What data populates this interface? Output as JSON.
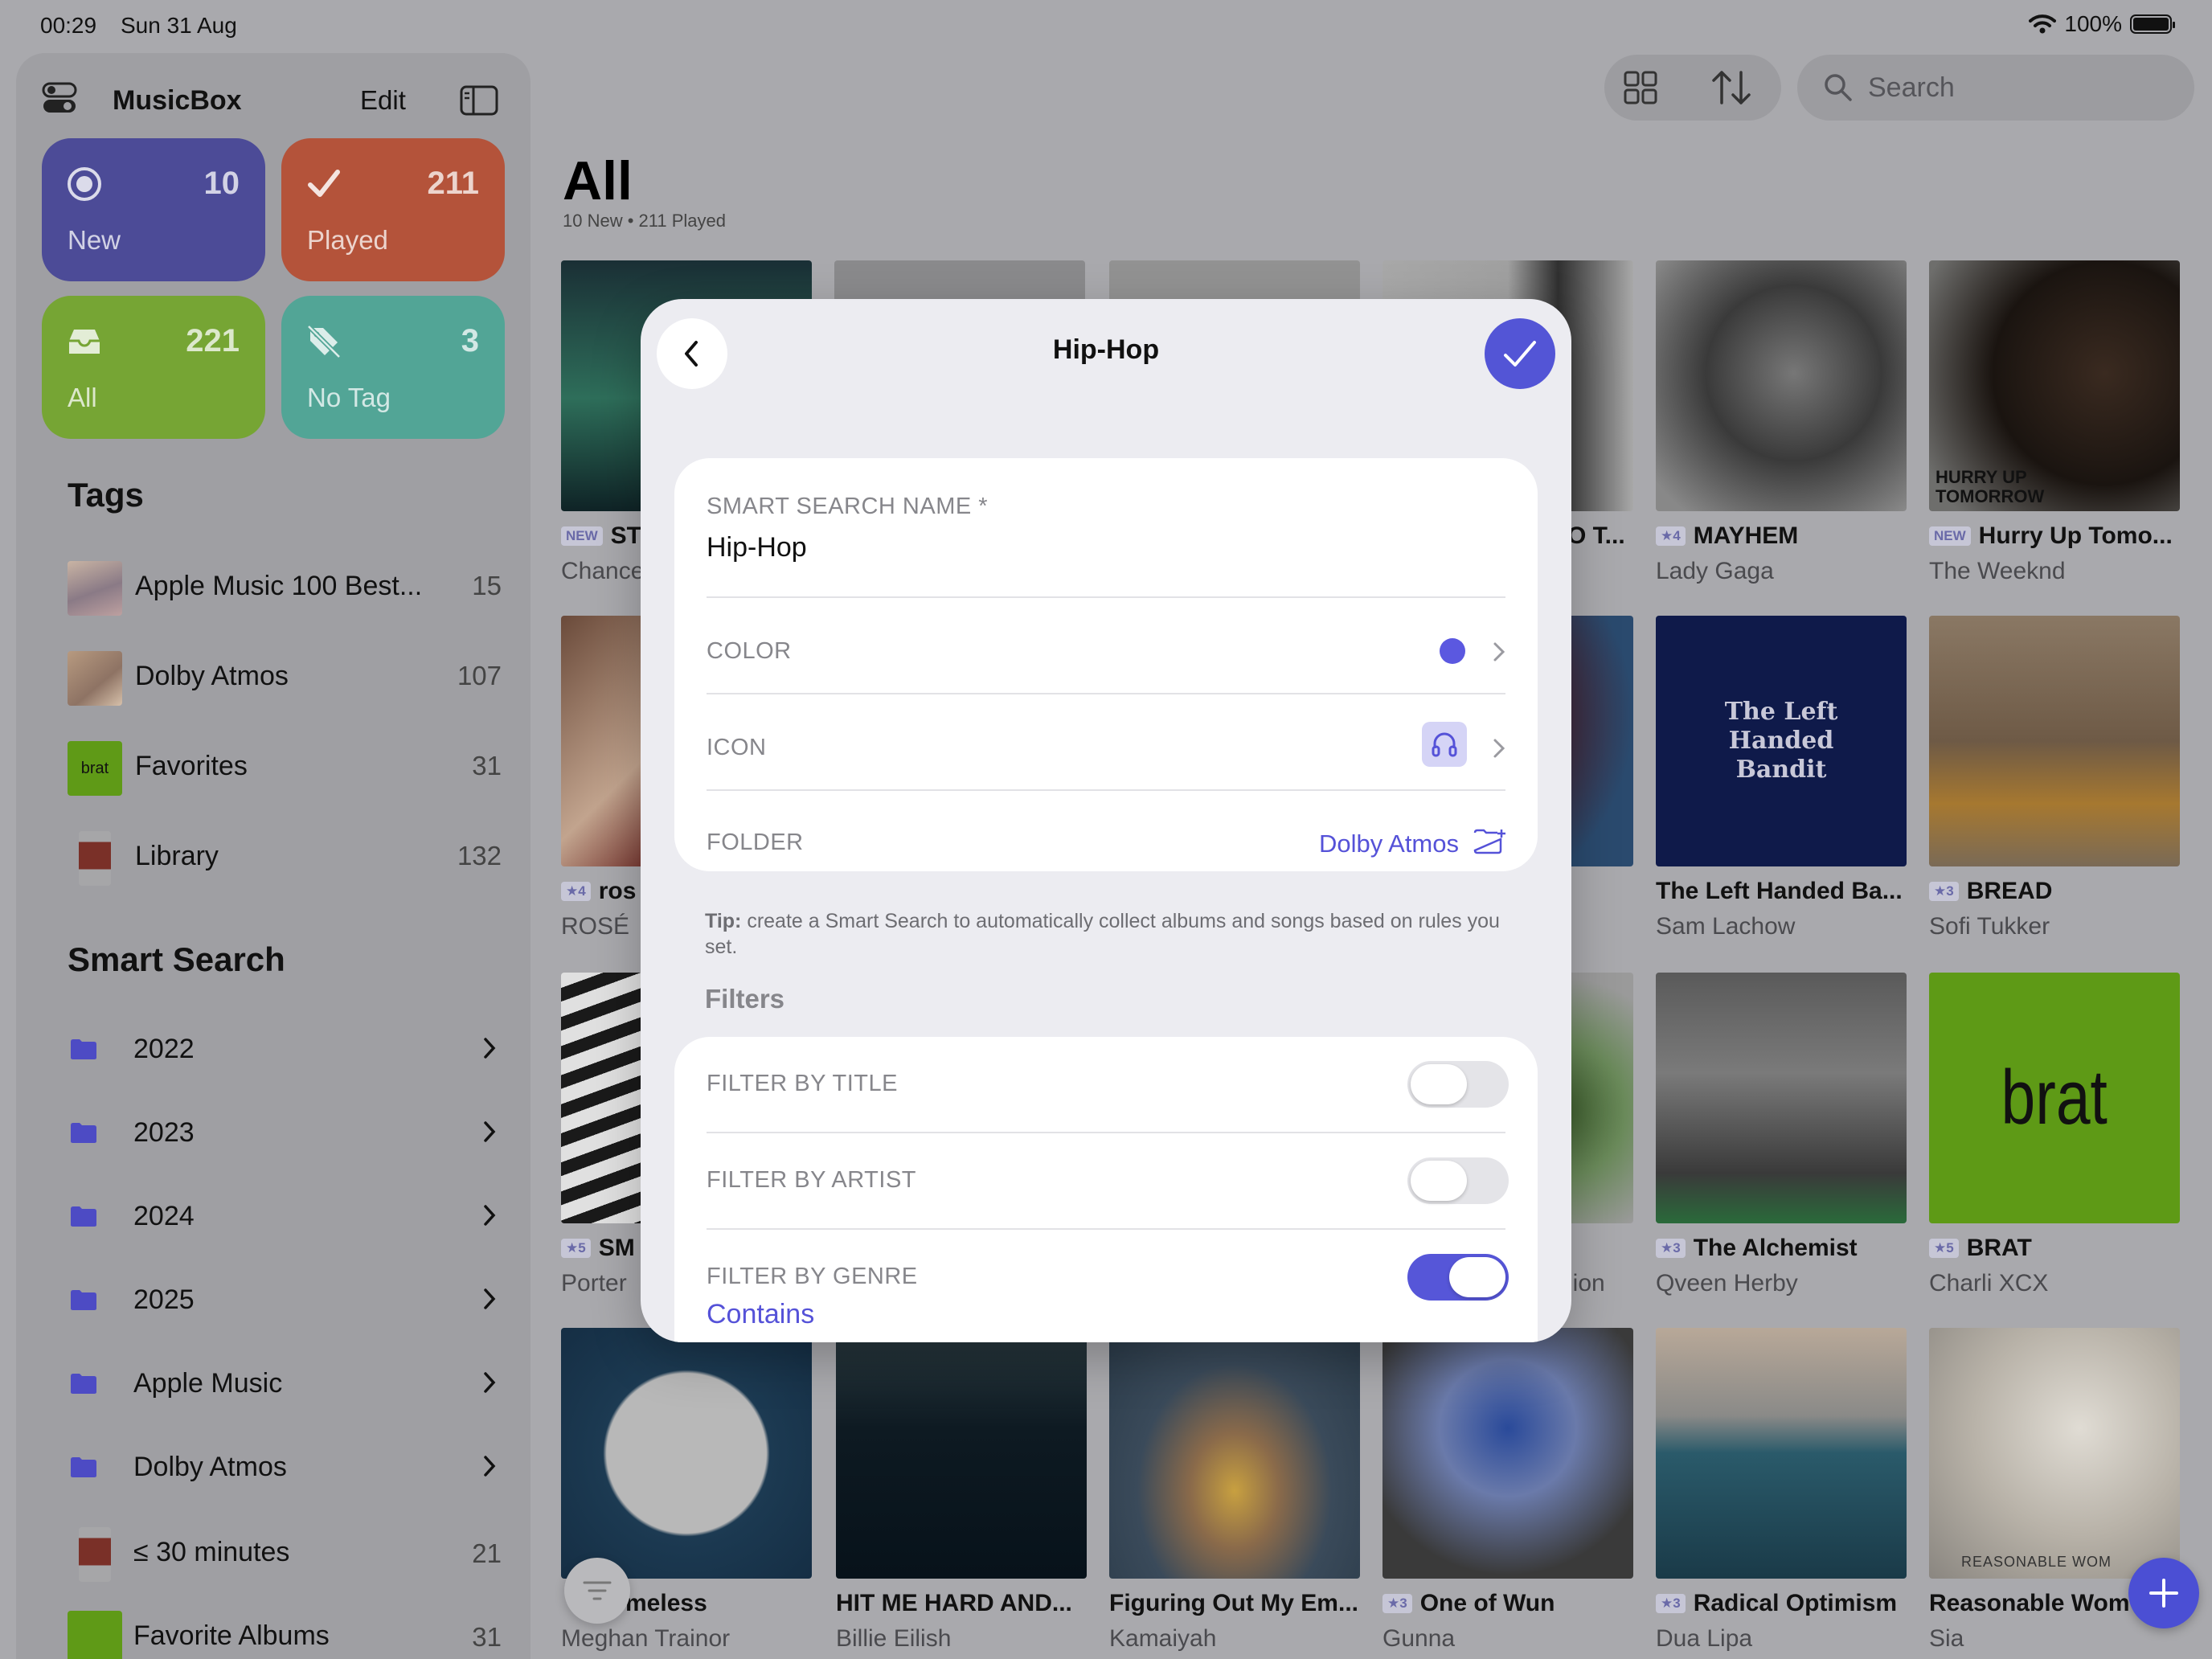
{
  "status_bar": {
    "time": "00:29",
    "date": "Sun 31 Aug",
    "battery": "100%"
  },
  "sidebar": {
    "app_title": "MusicBox",
    "edit_label": "Edit",
    "tiles": [
      {
        "label": "New",
        "count": "10",
        "icon": "circle-dot-icon",
        "color": "#4c4b97"
      },
      {
        "label": "Played",
        "count": "211",
        "icon": "checkmark-icon",
        "color": "#b4533a"
      },
      {
        "label": "All",
        "count": "221",
        "icon": "tray-icon",
        "color": "#76a534"
      },
      {
        "label": "No Tag",
        "count": "3",
        "icon": "tag-slash-icon",
        "color": "#52a596"
      }
    ],
    "tags_title": "Tags",
    "tags": [
      {
        "name": "Apple Music 100 Best...",
        "count": "15"
      },
      {
        "name": "Dolby Atmos",
        "count": "107"
      },
      {
        "name": "Favorites",
        "count": "31",
        "thumb_text": "brat"
      },
      {
        "name": "Library",
        "count": "132"
      }
    ],
    "smart_title": "Smart Search",
    "smart_folders": [
      {
        "name": "2022"
      },
      {
        "name": "2023"
      },
      {
        "name": "2024"
      },
      {
        "name": "2025"
      },
      {
        "name": "Apple Music"
      },
      {
        "name": "Dolby Atmos"
      }
    ],
    "smart_items": [
      {
        "name": "≤ 30 minutes",
        "count": "21"
      },
      {
        "name": "Favorite Albums",
        "count": "31"
      }
    ]
  },
  "toolbar": {
    "search_placeholder": "Search"
  },
  "main": {
    "title": "All",
    "subtitle": "10 New • 211 Played",
    "albums": [
      {
        "title": "ST",
        "artist": "Chance",
        "badge": "NEW"
      },
      {
        "title": "",
        "artist": ""
      },
      {
        "title": "",
        "artist": ""
      },
      {
        "title": "O T...",
        "artist": ""
      },
      {
        "title": "MAYHEM",
        "artist": "Lady Gaga",
        "badge": "★4"
      },
      {
        "title": "Hurry Up Tomo...",
        "artist": "The Weeknd",
        "badge": "NEW",
        "art_text": "HURRY UP TOMORROW"
      },
      {
        "title": "ros",
        "artist": "ROSÉ",
        "badge": "★4"
      },
      {
        "title": "The Left Handed Ba...",
        "artist": "Sam Lachow",
        "art_text": "The Left Handed Bandit"
      },
      {
        "title": "BREAD",
        "artist": "Sofi Tukker",
        "badge": "★3"
      },
      {
        "title": "SM",
        "artist": "Porter",
        "badge": "★5"
      },
      {
        "title": "",
        "artist": "lion"
      },
      {
        "title": "The Alchemist",
        "artist": "Qveen Herby",
        "badge": "★3"
      },
      {
        "title": "BRAT",
        "artist": "Charli XCX",
        "badge": "★5",
        "art_text": "brat"
      },
      {
        "title": "meless",
        "artist": "Meghan Trainor"
      },
      {
        "title": "HIT ME HARD AND...",
        "artist": "Billie Eilish"
      },
      {
        "title": "Figuring Out My Em...",
        "artist": "Kamaiyah"
      },
      {
        "title": "One of Wun",
        "artist": "Gunna",
        "badge": "★3"
      },
      {
        "title": "Radical Optimism",
        "artist": "Dua Lipa",
        "badge": "★3"
      },
      {
        "title": "Reasonable Wom",
        "artist": "Sia",
        "art_text": "REASONABLE WOM"
      }
    ]
  },
  "modal": {
    "title": "Hip-Hop",
    "name_label": "SMART SEARCH NAME *",
    "name_value": "Hip-Hop",
    "color_label": "COLOR",
    "color_value": "#5b58e0",
    "icon_label": "ICON",
    "icon_value": "headphones-icon",
    "folder_label": "FOLDER",
    "folder_value": "Dolby Atmos",
    "tip_bold": "Tip:",
    "tip_text": " create a Smart Search to automatically collect albums and songs based on rules you set.",
    "filters_heading": "Filters",
    "filters": [
      {
        "label": "FILTER BY TITLE",
        "enabled": false
      },
      {
        "label": "FILTER BY ARTIST",
        "enabled": false
      },
      {
        "label": "FILTER BY GENRE",
        "enabled": true
      }
    ],
    "genre_mode": "Contains"
  }
}
